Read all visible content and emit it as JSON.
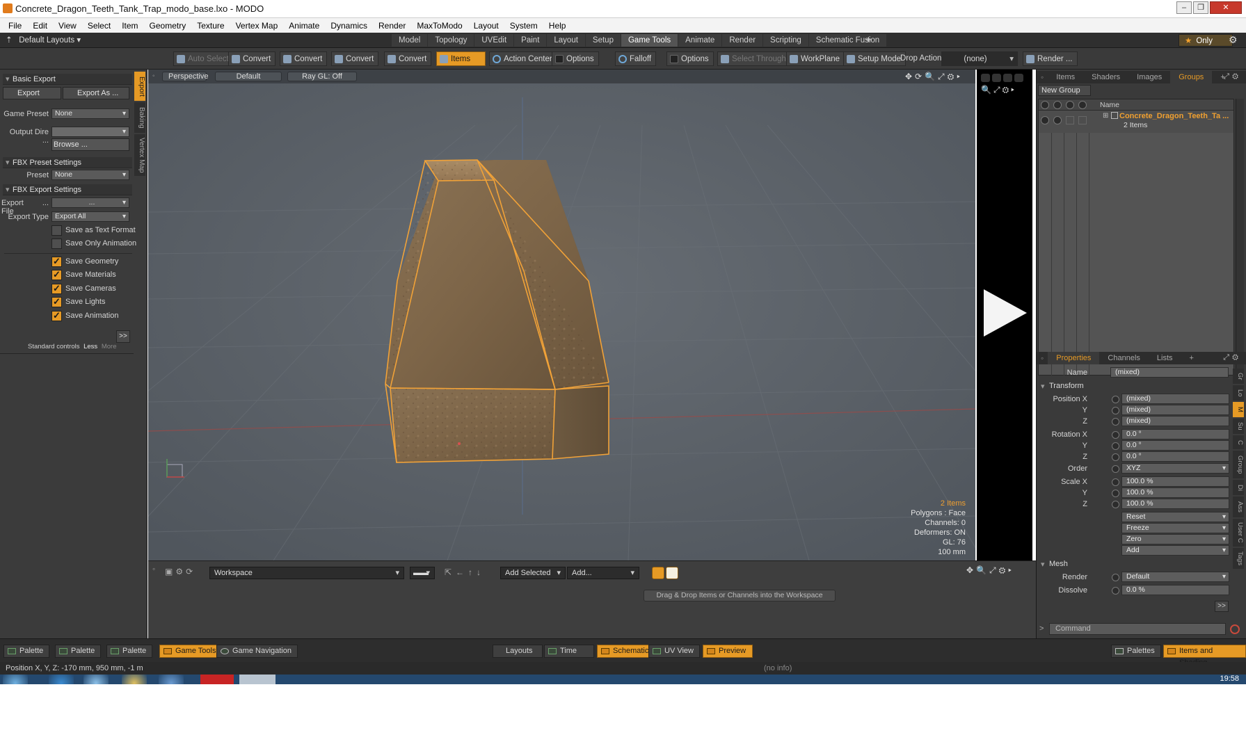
{
  "window": {
    "title": "Concrete_Dragon_Teeth_Tank_Trap_modo_base.lxo - MODO",
    "controls": [
      "–",
      "❐",
      "✕"
    ]
  },
  "menubar": [
    "File",
    "Edit",
    "View",
    "Select",
    "Item",
    "Geometry",
    "Texture",
    "Vertex Map",
    "Animate",
    "Dynamics",
    "Render",
    "MaxToModo",
    "Layout",
    "System",
    "Help"
  ],
  "layouts": {
    "current": "Default Layouts",
    "tabs": [
      "Model",
      "Topology",
      "UVEdit",
      "Paint",
      "Layout",
      "Setup",
      "Game Tools",
      "Animate",
      "Render",
      "Scripting",
      "Schematic Fusion"
    ],
    "active_tab": "Game Tools",
    "add": "+",
    "only_label": "Only"
  },
  "toolbar": {
    "auto_select": "Auto Select",
    "convert_1": "Convert",
    "convert_2": "Convert",
    "convert_3": "Convert",
    "convert_4": "Convert",
    "items": "Items",
    "action_center": "Action Center",
    "options_1": "Options",
    "falloff": "Falloff",
    "options_2": "Options",
    "select_through": "Select Through",
    "workplane": "WorkPlane",
    "setup_mode": "Setup Mode",
    "drop_action_label": "Drop Action",
    "drop_action_value": "(none)",
    "render": "Render ..."
  },
  "left_panel": {
    "vertical_tabs": [
      "Export",
      "Baking",
      "Vertex Map"
    ],
    "basic_export": "Basic Export",
    "export_btn": "Export",
    "export_as_btn": "Export As ...",
    "game_preset_label": "Game Preset",
    "game_preset_value": "None",
    "output_dir_label": "Output Dire ...",
    "browse": "Browse ...",
    "fbx_preset_settings": "FBX Preset Settings",
    "preset_label": "Preset",
    "preset_value": "None",
    "fbx_export_settings": "FBX Export Settings",
    "export_file_label": "Export File",
    "export_file_dots": "...",
    "export_file_value": "...",
    "export_type_label": "Export Type",
    "export_type_value": "Export All",
    "options": [
      {
        "label": "Save as Text Format",
        "checked": false
      },
      {
        "label": "Save Only Animation",
        "checked": false
      },
      {
        "label": "Save Geometry",
        "checked": true
      },
      {
        "label": "Save Materials",
        "checked": true
      },
      {
        "label": "Save Cameras",
        "checked": true
      },
      {
        "label": "Save Lights",
        "checked": true
      },
      {
        "label": "Save Animation",
        "checked": true
      }
    ],
    "more_btn": ">>",
    "standard_controls": "Standard controls",
    "less": "Less",
    "more": "More"
  },
  "viewport": {
    "view": "Perspective",
    "shading": "Default",
    "raygl": "Ray GL: Off",
    "hud": {
      "items": "2 Items",
      "polygons": "Polygons : Face",
      "channels": "Channels: 0",
      "deformers": "Deformers: ON",
      "gl": "GL: 76",
      "scale": "100 mm"
    }
  },
  "workspace": {
    "name": "Workspace",
    "add_selected": "Add Selected",
    "add": "Add...",
    "hint": "Drag & Drop Items or Channels into the Workspace"
  },
  "items_panel": {
    "tabs": [
      "Items",
      "Shaders",
      "Images",
      "Groups"
    ],
    "active_tab": "Groups",
    "new_group": "New Group",
    "name_col": "Name",
    "group_name": "Concrete_Dragon_Teeth_Ta ...",
    "group_count": "2 Items"
  },
  "properties": {
    "tabs": [
      "Properties",
      "Channels",
      "Lists"
    ],
    "active_tab": "Properties",
    "name_label": "Name",
    "name_value": "(mixed)",
    "transform": "Transform",
    "position_label": "Position X",
    "rotation_label": "Rotation X",
    "order_label": "Order",
    "scale_label": "Scale X",
    "y": "Y",
    "z": "Z",
    "position": [
      "(mixed)",
      "(mixed)",
      "(mixed)"
    ],
    "rotation": [
      "0.0 °",
      "0.0 °",
      "0.0 °"
    ],
    "order": "XYZ",
    "scale": [
      "100.0 %",
      "100.0 %",
      "100.0 %"
    ],
    "actions": [
      "Reset",
      "Freeze",
      "Zero",
      "Add"
    ],
    "mesh": "Mesh",
    "render_label": "Render",
    "render_value": "Default",
    "dissolve_label": "Dissolve",
    "dissolve_value": "0.0 %",
    "side_tabs": [
      "Gr",
      "Lo",
      "M",
      "Su",
      "C",
      "Group",
      "Di",
      "Ass",
      "User C",
      "Tags"
    ],
    "command_placeholder": "Command"
  },
  "bottom_bar": {
    "palette_1": "Palette",
    "palette_2": "Palette",
    "palette_3": "Palette",
    "game_tools": "Game Tools",
    "game_navigation": "Game Navigation",
    "layouts": "Layouts",
    "time": "Time",
    "schematic": "Schematic",
    "uv_view": "UV View",
    "preview": "Preview",
    "palettes": "Palettes",
    "items_and_shading": "Items and Shading"
  },
  "status": {
    "position": "Position X, Y, Z:  -170 mm, 950 mm, -1 m",
    "info": "(no info)"
  },
  "taskbar": {
    "clock": "19:58"
  },
  "colors": {
    "accent": "#e69a25",
    "panel": "#3a3a3a",
    "viewport": "#5b6168"
  }
}
